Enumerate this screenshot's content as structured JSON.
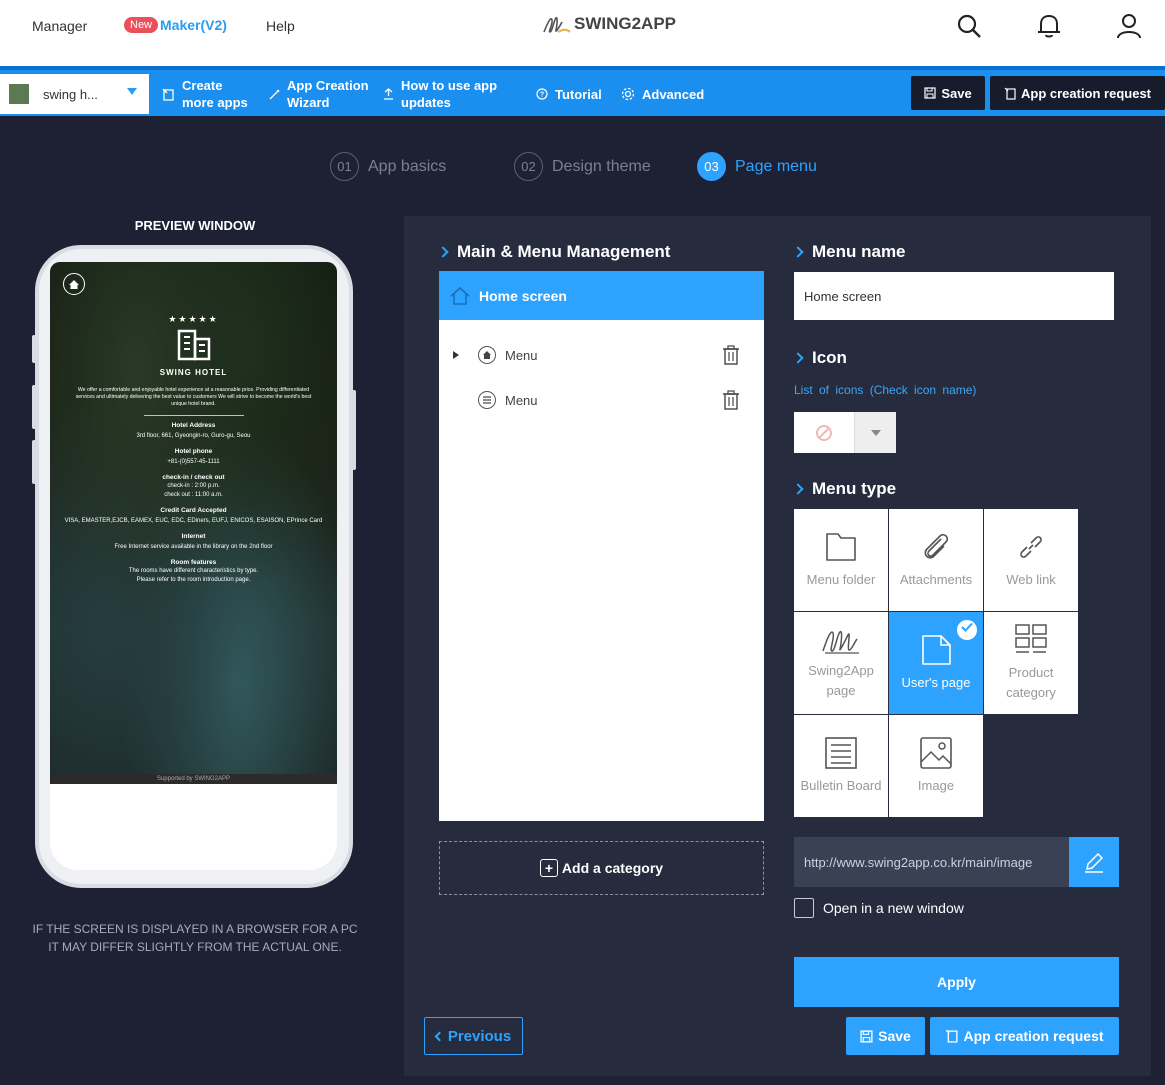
{
  "topnav": {
    "manager": "Manager",
    "new_badge": "New",
    "maker": "Maker(V2)",
    "help": "Help",
    "logo": "SWING2APP"
  },
  "toolbar": {
    "app_name": "swing h...",
    "create_more": [
      "Create",
      "more apps"
    ],
    "wizard": [
      "App Creation",
      "Wizard"
    ],
    "how_to": [
      "How to use app",
      "updates"
    ],
    "tutorial": "Tutorial",
    "advanced": "Advanced",
    "save": "Save",
    "request": "App creation request"
  },
  "steps": [
    {
      "num": "01",
      "label": "App basics"
    },
    {
      "num": "02",
      "label": "Design theme"
    },
    {
      "num": "03",
      "label": "Page menu"
    }
  ],
  "preview": {
    "title": "PREVIEW WINDOW",
    "note_line1": "IF THE SCREEN IS DISPLAYED IN A BROWSER FOR A PC",
    "note_line2": "IT MAY DIFFER SLIGHTLY FROM THE ACTUAL ONE.",
    "hotel_name": "SWING HOTEL",
    "stars": "★★★★★",
    "intro": "We offer a comfortable and enjoyable hotel experience at a reasonable price. Providing differentiated services and ultimately delivering the best value to customers We will strive to become the world's best unique hotel brand.",
    "address_title": "Hotel Address",
    "address": "3rd floor, 661, Gyeongin-ro, Guro-gu, Seou",
    "phone_title": "Hotel phone",
    "phone": "+81-(0)557-45-1111",
    "check_title": "check-in / check out",
    "check_in": "check-in : 2:00 p.m.",
    "check_out": "check out : 11:00 a.m.",
    "card_title": "Credit Card Accepted",
    "cards": "VISA, EMASTER,EJCB, EAMEX, EUC, EDC, EDiners, EUFJ, ENICOS, ESAISON, EPrince Card",
    "internet_title": "Internet",
    "internet": "Free Internet service available in the library on the 2nd floor",
    "room_title": "Room features",
    "room1": "The rooms have different characteristics by type.",
    "room2": "Please refer to the room introduction page.",
    "footer": "Supported by SWING2APP"
  },
  "menu_mgmt": {
    "title": "Main & Menu Management",
    "home": "Home screen",
    "items": [
      "Menu",
      "Menu"
    ],
    "add_category": "Add a category"
  },
  "menu_name": {
    "title": "Menu name",
    "value": "Home screen"
  },
  "icon": {
    "title": "Icon",
    "list_link": "List of icons (Check icon name)"
  },
  "menu_type": {
    "title": "Menu type",
    "types": [
      {
        "label": "Menu folder",
        "icon": "folder-icon"
      },
      {
        "label": "Attachments",
        "icon": "paperclip-icon"
      },
      {
        "label": "Web link",
        "icon": "link-icon"
      },
      {
        "label": "Swing2App page",
        "icon": "swing2app-icon"
      },
      {
        "label": "User's page",
        "icon": "page-icon"
      },
      {
        "label": "Product category",
        "icon": "grid-icon"
      },
      {
        "label": "Bulletin Board",
        "icon": "list-icon"
      },
      {
        "label": "Image",
        "icon": "image-icon"
      }
    ],
    "selected": "User's page"
  },
  "url": {
    "value": "http://www.swing2app.co.kr/main/image"
  },
  "open_new_window": "Open in a new window",
  "buttons": {
    "apply": "Apply",
    "previous": "Previous",
    "save": "Save",
    "request": "App creation request"
  },
  "colors": {
    "accent": "#2da3ff",
    "background": "#1d2133",
    "panel": "#262b3e",
    "toolbar": "#1b8ff0"
  }
}
